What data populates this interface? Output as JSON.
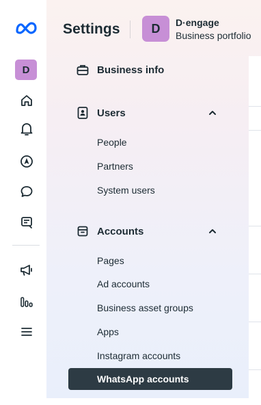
{
  "rail": {
    "logo_icon": "meta-logo-icon",
    "account_initial": "D",
    "icons_top": [
      "home-icon",
      "bell-icon",
      "compass-icon",
      "chat-icon",
      "ads-manager-icon"
    ],
    "icons_bottom": [
      "megaphone-icon",
      "insights-icon",
      "menu-icon"
    ]
  },
  "header": {
    "title": "Settings",
    "portfolio_initial": "D",
    "portfolio_name": "D·engage",
    "portfolio_subtitle": "Business portfolio"
  },
  "sections": {
    "business_info": {
      "label": "Business info",
      "icon": "briefcase-icon"
    },
    "users": {
      "label": "Users",
      "icon": "user-badge-icon",
      "expanded": true,
      "items": [
        "People",
        "Partners",
        "System users"
      ]
    },
    "accounts": {
      "label": "Accounts",
      "icon": "archive-box-icon",
      "expanded": true,
      "items": [
        "Pages",
        "Ad accounts",
        "Business asset groups",
        "Apps",
        "Instagram accounts",
        "WhatsApp accounts"
      ],
      "selected": "WhatsApp accounts"
    }
  },
  "colors": {
    "accent_avatar": "#c78fd6",
    "meta_blue": "#0866ff",
    "active_bg": "#2d3b44",
    "text": "#1c2b33"
  }
}
